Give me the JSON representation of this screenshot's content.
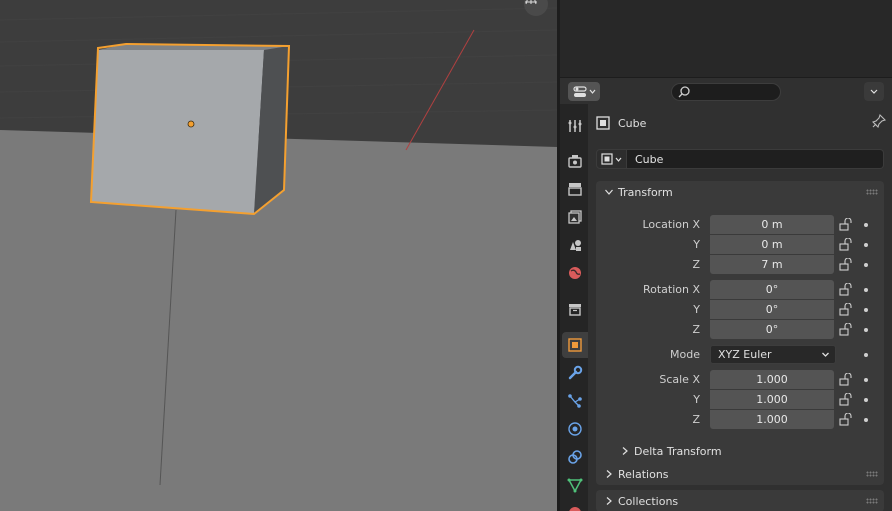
{
  "viewport": {
    "name": "3D Viewport",
    "gizmo_icon": "grid-icon"
  },
  "properties": {
    "search_placeholder": "",
    "context": {
      "object_name": "Cube",
      "icon": "object-icon"
    },
    "datablock": {
      "name": "Cube"
    },
    "tabs": [
      {
        "name": "tool",
        "icon": "tool-icon",
        "color": "#c6c6c6"
      },
      {
        "name": "render",
        "icon": "render-icon",
        "color": "#c6c6c6"
      },
      {
        "name": "output",
        "icon": "output-icon",
        "color": "#c6c6c6"
      },
      {
        "name": "view-layer",
        "icon": "view-layer-icon",
        "color": "#c6c6c6"
      },
      {
        "name": "scene",
        "icon": "scene-icon",
        "color": "#c6c6c6"
      },
      {
        "name": "world",
        "icon": "world-icon",
        "color": "#d95b5b"
      },
      {
        "name": "collection",
        "icon": "collection-icon",
        "color": "#c6c6c6"
      },
      {
        "name": "object",
        "icon": "object-icon",
        "color": "#ef9a3b",
        "active": true
      },
      {
        "name": "modifiers",
        "icon": "wrench-icon",
        "color": "#6aa3e8"
      },
      {
        "name": "particles",
        "icon": "particles-icon",
        "color": "#6aa3e8"
      },
      {
        "name": "physics",
        "icon": "physics-icon",
        "color": "#6aa3e8"
      },
      {
        "name": "constraints",
        "icon": "constraints-icon",
        "color": "#6aa3e8"
      },
      {
        "name": "data",
        "icon": "mesh-data-icon",
        "color": "#4fc27a"
      },
      {
        "name": "material",
        "icon": "material-icon",
        "color": "#d95b5b"
      }
    ],
    "transform": {
      "title": "Transform",
      "location_label": "Location X",
      "y_label": "Y",
      "z_label": "Z",
      "location": {
        "x": "0 m",
        "y": "0 m",
        "z": "7 m"
      },
      "rotation_label": "Rotation X",
      "rotation": {
        "x": "0°",
        "y": "0°",
        "z": "0°"
      },
      "mode_label": "Mode",
      "mode_value": "XYZ Euler",
      "scale_label": "Scale X",
      "scale": {
        "x": "1.000",
        "y": "1.000",
        "z": "1.000"
      },
      "delta_title": "Delta Transform"
    },
    "relations_title": "Relations",
    "collections_title": "Collections"
  },
  "colors": {
    "selection_outline": "#f4a030",
    "origin_dot": "#f4a030",
    "axis_x": "#b04040"
  }
}
